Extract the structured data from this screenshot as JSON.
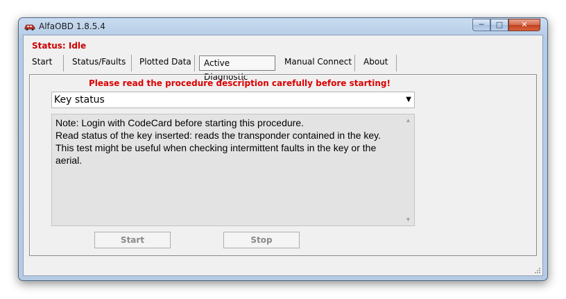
{
  "window": {
    "title": "AlfaOBD 1.8.5.4"
  },
  "title_controls": {
    "minimize": "─",
    "maximize": "□",
    "close": "✕"
  },
  "status": {
    "text": "Status: Idle"
  },
  "tabs": [
    {
      "label": "Start",
      "active": false
    },
    {
      "label": "Status/Faults",
      "active": false
    },
    {
      "label": "Plotted Data",
      "active": false
    },
    {
      "label": "Active Diagnostic",
      "active": true
    },
    {
      "label": "Manual Connect",
      "active": false
    },
    {
      "label": "About",
      "active": false
    }
  ],
  "diagnostic": {
    "warning": "Please read the procedure description carefully before starting!",
    "procedure_selected": "Key status",
    "description": [
      "Note: Login with CodeCard before starting this procedure.",
      "Read status of the key inserted: reads the transponder contained in the key.",
      "This test might be useful when checking intermittent faults in the key or the aerial."
    ],
    "start_label": "Start",
    "stop_label": "Stop"
  },
  "colors": {
    "status": "#cc0000",
    "warning": "#dd0000"
  }
}
